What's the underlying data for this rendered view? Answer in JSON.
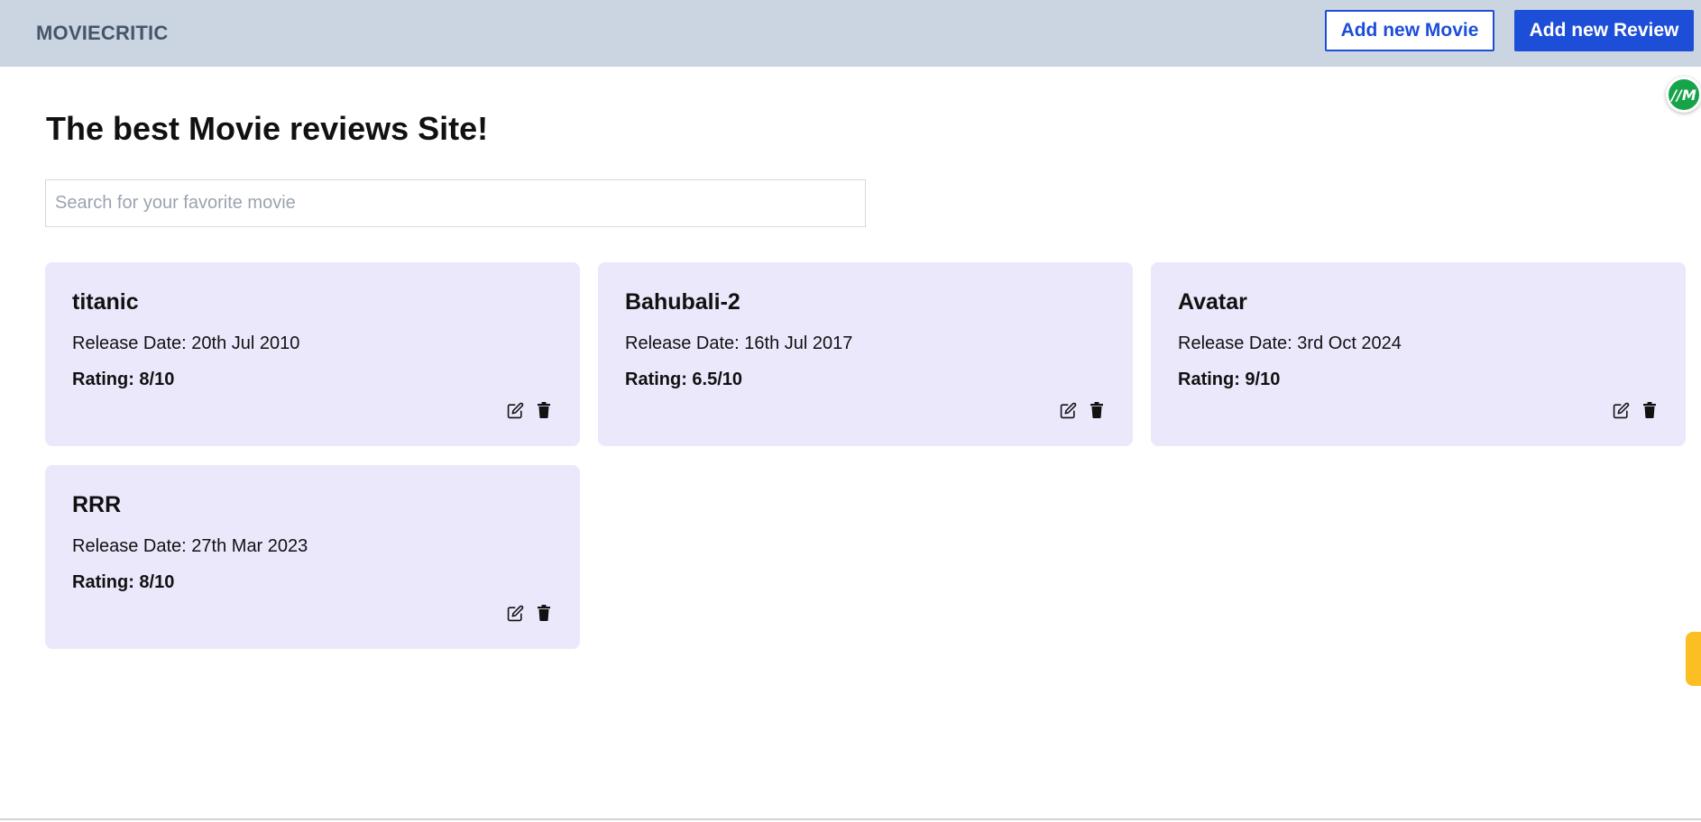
{
  "header": {
    "brand": "MOVIECRITIC",
    "add_movie_label": "Add new Movie",
    "add_review_label": "Add new Review"
  },
  "extension_badge": {
    "label": "//M",
    "color": "#16a34a"
  },
  "main": {
    "title": "The best Movie reviews Site!",
    "search": {
      "placeholder": "Search for your favorite movie",
      "value": ""
    }
  },
  "movies": [
    {
      "title": "titanic",
      "release": "Release Date: 20th Jul 2010",
      "rating": "Rating: 8/10"
    },
    {
      "title": "Bahubali-2",
      "release": "Release Date: 16th Jul 2017",
      "rating": "Rating: 6.5/10"
    },
    {
      "title": "Avatar",
      "release": "Release Date: 3rd Oct 2024",
      "rating": "Rating: 9/10"
    },
    {
      "title": "RRR",
      "release": "Release Date: 27th Mar 2023",
      "rating": "Rating: 8/10"
    }
  ],
  "icons": {
    "edit": "edit-icon",
    "delete": "trash-icon"
  },
  "colors": {
    "header_bg": "#cbd5e1",
    "brand_text": "#475569",
    "primary": "#1d4ed8",
    "card_bg": "#ebe8fc",
    "badge_green": "#16a34a",
    "side_tab_yellow": "#fbbf24"
  }
}
